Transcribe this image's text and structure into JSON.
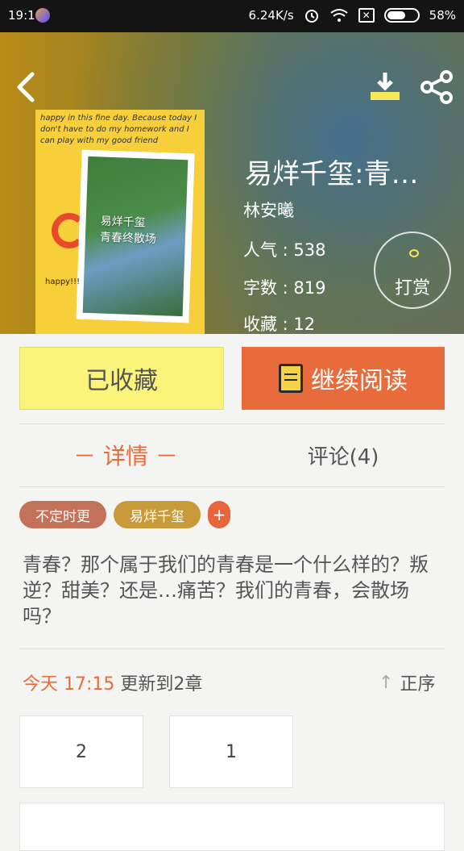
{
  "status_bar": {
    "time": "19:10",
    "net_speed": "6.24K/s",
    "battery": "58%"
  },
  "book": {
    "title": "易烊千玺:青…",
    "author": "林安曦",
    "popularity": "人气 : 538",
    "words": "字数 : 819",
    "favorites": "收藏 : 12"
  },
  "cover": {
    "scribble": "happy in this fine day. Because today I don't have to do my homework and I can play with my good friend",
    "title_line1": "易烊千玺",
    "title_line2": "青春终散场",
    "doodle": "happy!!!"
  },
  "reward_label": "打赏",
  "buttons": {
    "favorited": "已收藏",
    "continue": "继续阅读"
  },
  "tabs": {
    "detail": "－ 详情 －",
    "comments": "评论(4)"
  },
  "tags": [
    "不定时更",
    "易烊千玺",
    "+"
  ],
  "description": "青春？那个属于我们的青春是一个什么样的？叛逆？甜美？还是…痛苦？我们的青春，会散场吗？",
  "update": {
    "day": "今天",
    "time": "17:15",
    "text": "更新到2章"
  },
  "sort_label": "正序",
  "chapters": [
    "2",
    "1"
  ],
  "colors": {
    "accent": "#e86c3b",
    "favorited_bg": "#fbf47a"
  }
}
